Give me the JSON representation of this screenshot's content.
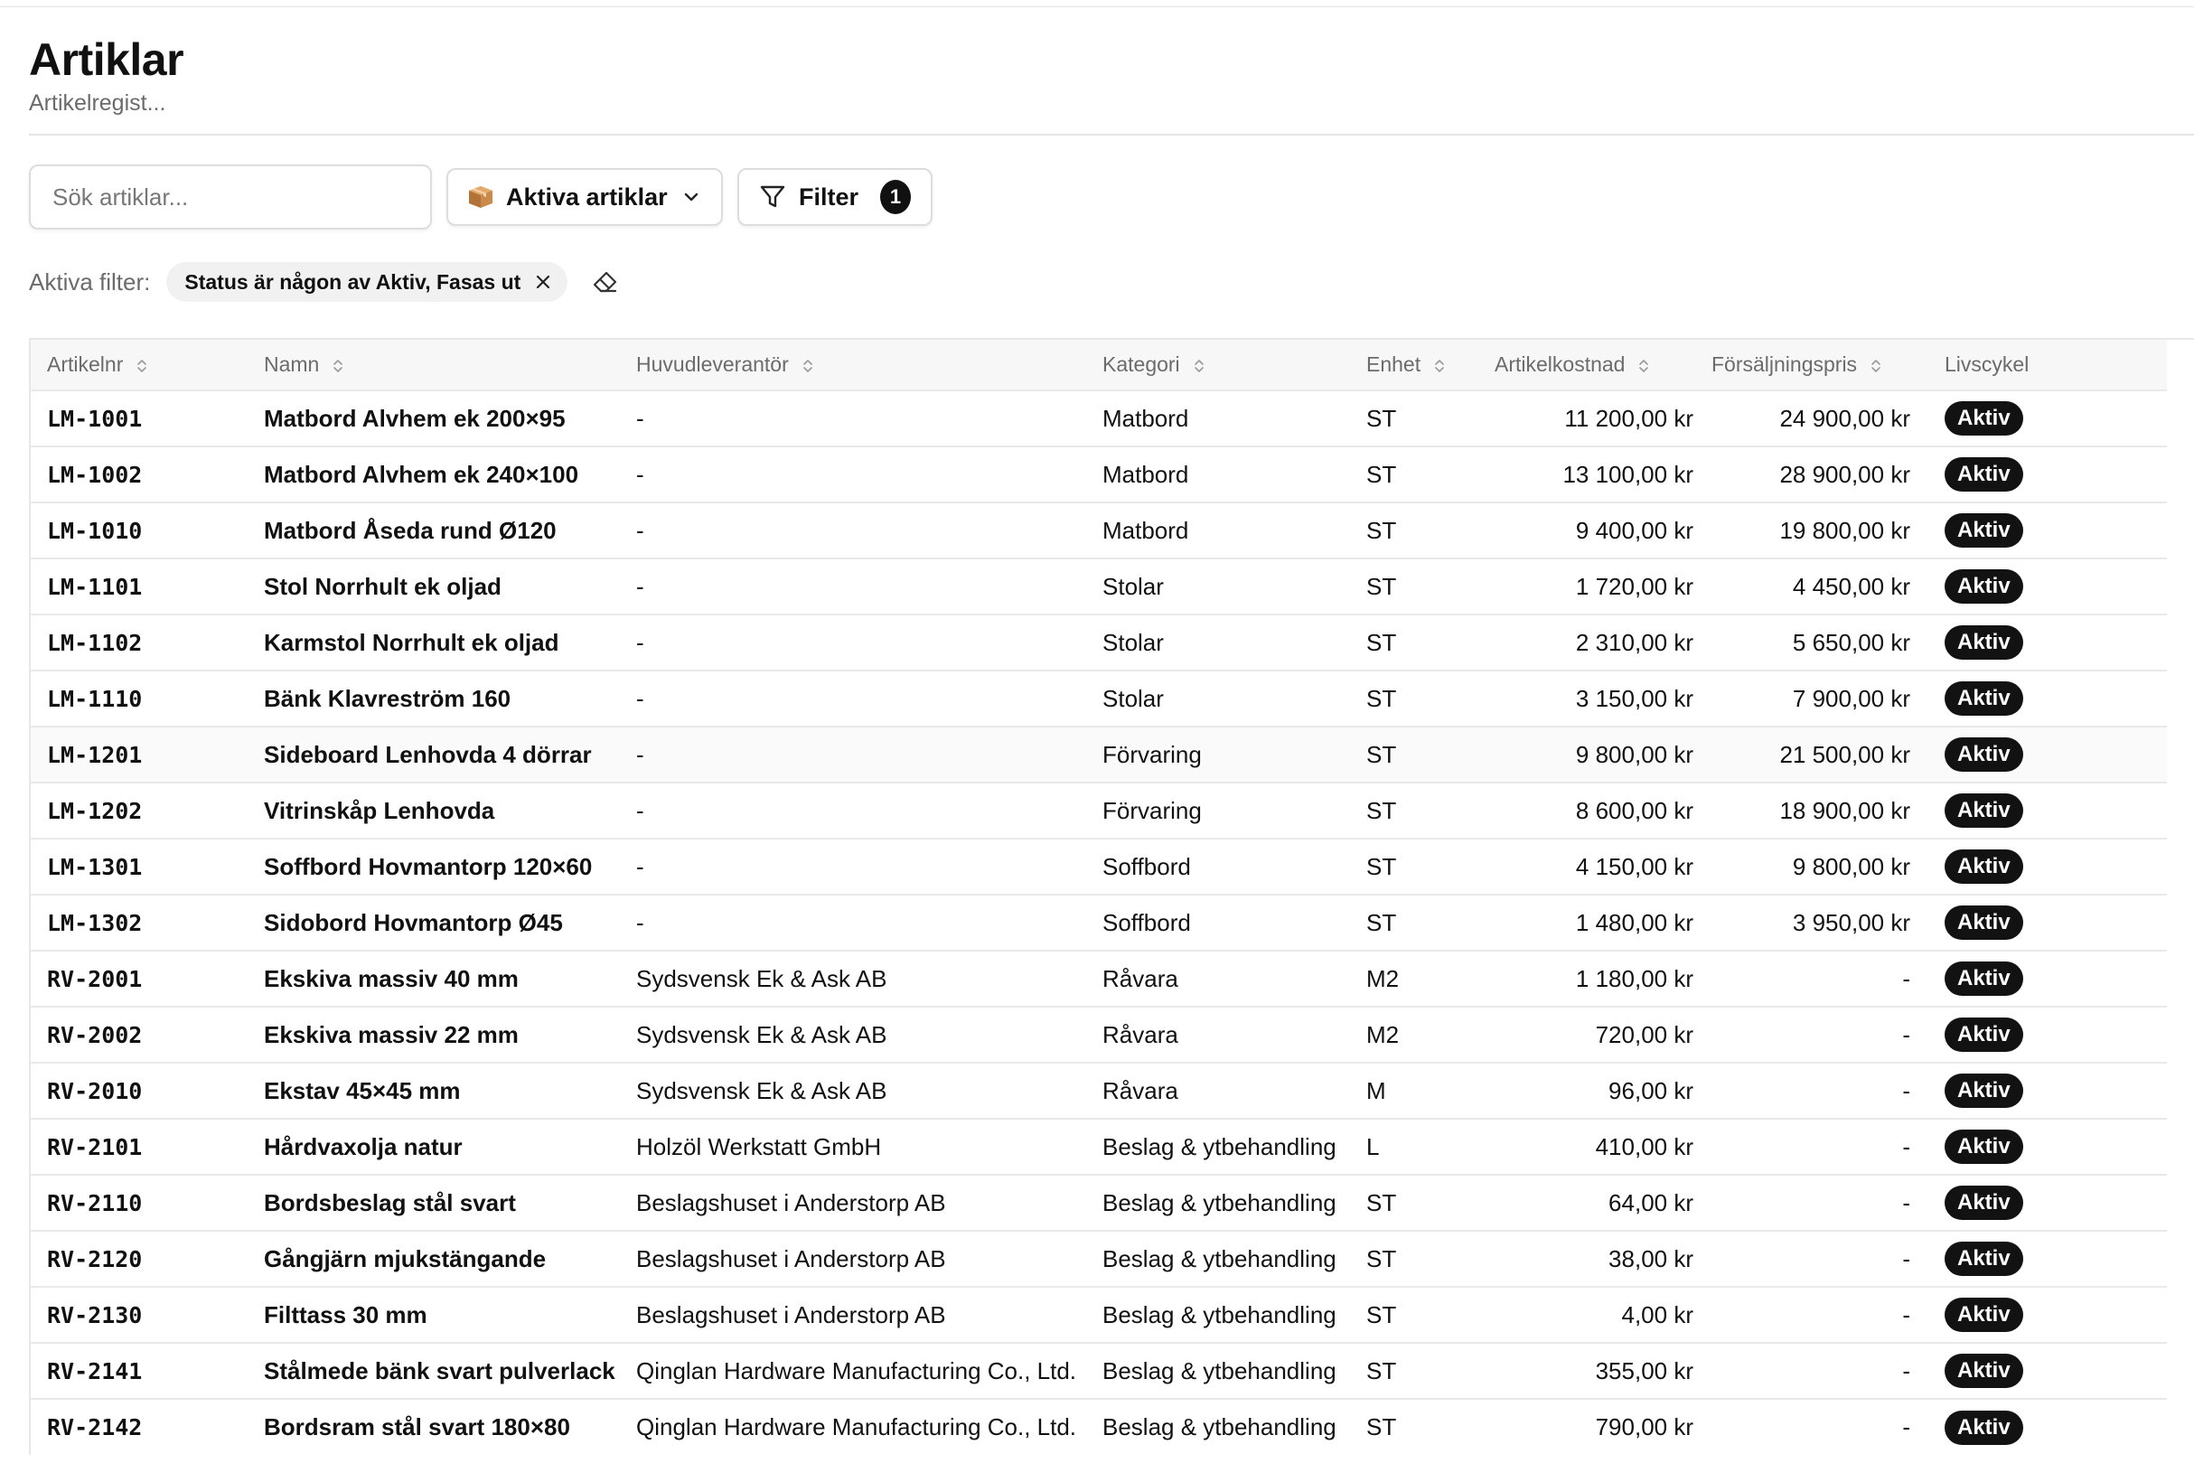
{
  "page": {
    "title": "Artiklar",
    "subtitle": "Artikelregist..."
  },
  "toolbar": {
    "search_placeholder": "Sök artiklar...",
    "select_label": "Aktiva artiklar",
    "filter_label": "Filter",
    "filter_count": "1"
  },
  "active_filters": {
    "label": "Aktiva filter:",
    "chips": [
      "Status är någon av Aktiv, Fasas ut"
    ]
  },
  "table": {
    "columns": [
      "Artikelnr",
      "Namn",
      "Huvudleverantör",
      "Kategori",
      "Enhet",
      "Artikelkostnad",
      "Försäljningspris",
      "Livscykel"
    ],
    "rows": [
      [
        "LM-1001",
        "Matbord Alvhem ek 200×95",
        "-",
        "Matbord",
        "ST",
        "11 200,00 kr",
        "24 900,00 kr",
        "Aktiv"
      ],
      [
        "LM-1002",
        "Matbord Alvhem ek 240×100",
        "-",
        "Matbord",
        "ST",
        "13 100,00 kr",
        "28 900,00 kr",
        "Aktiv"
      ],
      [
        "LM-1010",
        "Matbord Åseda rund Ø120",
        "-",
        "Matbord",
        "ST",
        "9 400,00 kr",
        "19 800,00 kr",
        "Aktiv"
      ],
      [
        "LM-1101",
        "Stol Norrhult ek oljad",
        "-",
        "Stolar",
        "ST",
        "1 720,00 kr",
        "4 450,00 kr",
        "Aktiv"
      ],
      [
        "LM-1102",
        "Karmstol Norrhult ek oljad",
        "-",
        "Stolar",
        "ST",
        "2 310,00 kr",
        "5 650,00 kr",
        "Aktiv"
      ],
      [
        "LM-1110",
        "Bänk Klavreström 160",
        "-",
        "Stolar",
        "ST",
        "3 150,00 kr",
        "7 900,00 kr",
        "Aktiv"
      ],
      [
        "LM-1201",
        "Sideboard Lenhovda 4 dörrar",
        "-",
        "Förvaring",
        "ST",
        "9 800,00 kr",
        "21 500,00 kr",
        "Aktiv"
      ],
      [
        "LM-1202",
        "Vitrinskåp Lenhovda",
        "-",
        "Förvaring",
        "ST",
        "8 600,00 kr",
        "18 900,00 kr",
        "Aktiv"
      ],
      [
        "LM-1301",
        "Soffbord Hovmantorp 120×60",
        "-",
        "Soffbord",
        "ST",
        "4 150,00 kr",
        "9 800,00 kr",
        "Aktiv"
      ],
      [
        "LM-1302",
        "Sidobord Hovmantorp Ø45",
        "-",
        "Soffbord",
        "ST",
        "1 480,00 kr",
        "3 950,00 kr",
        "Aktiv"
      ],
      [
        "RV-2001",
        "Ekskiva massiv 40 mm",
        "Sydsvensk Ek & Ask AB",
        "Råvara",
        "M2",
        "1 180,00 kr",
        "-",
        "Aktiv"
      ],
      [
        "RV-2002",
        "Ekskiva massiv 22 mm",
        "Sydsvensk Ek & Ask AB",
        "Råvara",
        "M2",
        "720,00 kr",
        "-",
        "Aktiv"
      ],
      [
        "RV-2010",
        "Ekstav 45×45 mm",
        "Sydsvensk Ek & Ask AB",
        "Råvara",
        "M",
        "96,00 kr",
        "-",
        "Aktiv"
      ],
      [
        "RV-2101",
        "Hårdvaxolja natur",
        "Holzöl Werkstatt GmbH",
        "Beslag & ytbehandling",
        "L",
        "410,00 kr",
        "-",
        "Aktiv"
      ],
      [
        "RV-2110",
        "Bordsbeslag stål svart",
        "Beslagshuset i Anderstorp AB",
        "Beslag & ytbehandling",
        "ST",
        "64,00 kr",
        "-",
        "Aktiv"
      ],
      [
        "RV-2120",
        "Gångjärn mjukstängande",
        "Beslagshuset i Anderstorp AB",
        "Beslag & ytbehandling",
        "ST",
        "38,00 kr",
        "-",
        "Aktiv"
      ],
      [
        "RV-2130",
        "Filttass 30 mm",
        "Beslagshuset i Anderstorp AB",
        "Beslag & ytbehandling",
        "ST",
        "4,00 kr",
        "-",
        "Aktiv"
      ],
      [
        "RV-2141",
        "Stålmede bänk svart pulverlack",
        "Qinglan Hardware Manufacturing Co., Ltd.",
        "Beslag & ytbehandling",
        "ST",
        "355,00 kr",
        "-",
        "Aktiv"
      ],
      [
        "RV-2142",
        "Bordsram stål svart 180×80",
        "Qinglan Hardware Manufacturing Co., Ltd.",
        "Beslag & ytbehandling",
        "ST",
        "790,00 kr",
        "-",
        "Aktiv"
      ]
    ]
  },
  "icons": {
    "select": "package-icon",
    "dropdown": "chevron-down-icon",
    "filter": "funnel-icon",
    "chip_remove": "close-icon",
    "clear_filters": "eraser-icon",
    "sort": "sort-icon"
  },
  "colors": {
    "badge_bg": "#121212",
    "badge_text": "#ffffff",
    "muted_text": "#6b6b6b",
    "border": "#e7e7e7"
  }
}
